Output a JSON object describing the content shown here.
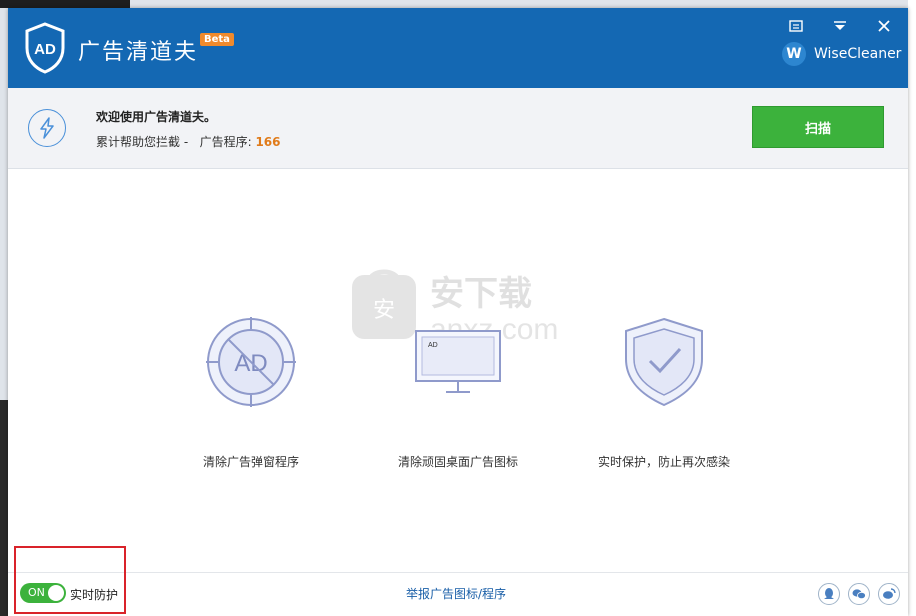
{
  "app": {
    "title": "广告清道夫",
    "beta_badge": "Beta",
    "brand_letter": "W",
    "brand_name": "WiseCleaner"
  },
  "header": {
    "welcome": "欢迎使用广告清道夫。",
    "stat_prefix": "累计帮助您拦截 -   广告程序: ",
    "stat_count": "166",
    "scan_button": "扫描"
  },
  "features": [
    {
      "icon": "ad-block-icon",
      "label": "清除广告弹窗程序",
      "icon_text": "AD"
    },
    {
      "icon": "desktop-monitor-icon",
      "label": "清除顽固桌面广告图标",
      "icon_text": "AD"
    },
    {
      "icon": "shield-check-icon",
      "label": "实时保护，防止再次感染"
    }
  ],
  "watermark": {
    "title": "安下载",
    "sub": "anxz.com",
    "logo_char": "安"
  },
  "footer": {
    "toggle_state": "ON",
    "realtime_label": "实时防护",
    "report_link": "举报广告图标/程序"
  },
  "colors": {
    "titlebar": "#1468b3",
    "accent_green": "#3cb23c",
    "count_orange": "#e07b1a",
    "beta_orange": "#f08a2c",
    "highlight_red": "#d9232a"
  }
}
